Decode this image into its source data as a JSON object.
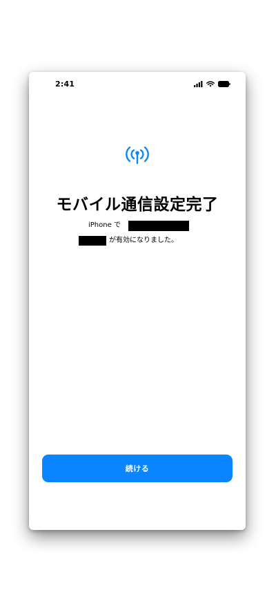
{
  "status_bar": {
    "time": "2:41",
    "icons": [
      "cellular-signal-icon",
      "wifi-icon",
      "battery-icon"
    ]
  },
  "header_icon": "antenna-signal-icon",
  "title": "モバイル通信設定完了",
  "description": {
    "line1_prefix": "iPhone で",
    "line2_suffix": "が有効になりました。"
  },
  "continue_button_label": "続ける",
  "colors": {
    "accent": "#0a84ff",
    "redaction": "#000000"
  }
}
